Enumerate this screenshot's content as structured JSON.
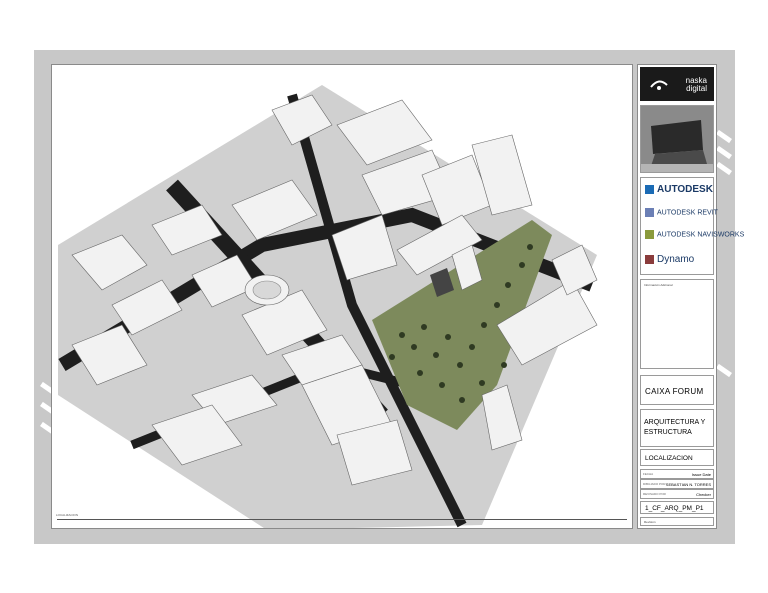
{
  "titleblock": {
    "logo_text_line1": "naska",
    "logo_text_line2": "digital",
    "photo_icon": "building-photo",
    "software": [
      {
        "name": "AUTODESK",
        "color": "#1b3a66",
        "icon": "autodesk-icon"
      },
      {
        "name": "AUTODESK REVIT",
        "color": "#1b3a66",
        "icon": "revit-icon"
      },
      {
        "name": "AUTODESK NAVISWORKS",
        "color": "#1b3a66",
        "icon": "navisworks-icon"
      },
      {
        "name": "Dynamo",
        "color": "#1b3a66",
        "icon": "dynamo-icon"
      }
    ],
    "info_label": "Información Adicional",
    "project": "CAIXA FORUM",
    "section": "ARQUITECTURA Y ESTRUCTURA",
    "view": "LOCALIZACION",
    "meta": [
      {
        "label": "FECHA",
        "value": "Issue Date"
      },
      {
        "label": "DIBUJADO POR",
        "value": "SEBASTIAN N. TORRES"
      },
      {
        "label": "REVISADO POR",
        "value": "Checker"
      }
    ],
    "code": "1_CF_ARQ_PM_P1",
    "revision_label": "Revisión"
  },
  "drawing": {
    "scale_label": "LOCALIZACION",
    "park_color": "#7d8a5c",
    "road_color": "#1e1e1e",
    "block_color": "#f2f2f2"
  }
}
